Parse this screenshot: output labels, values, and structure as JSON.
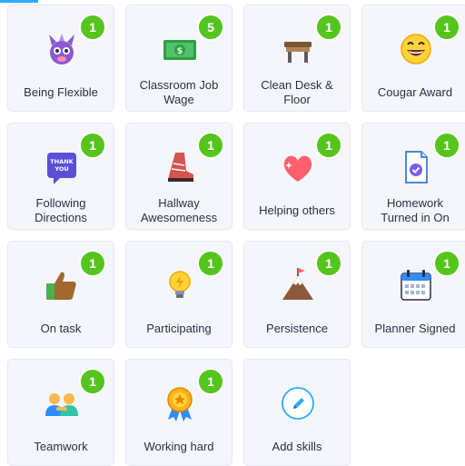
{
  "skills": [
    {
      "label": "Being Flexible",
      "count": "1",
      "icon": "monster-icon"
    },
    {
      "label": "Classroom Job\nWage",
      "count": "5",
      "icon": "money-icon"
    },
    {
      "label": "Clean Desk &\nFloor",
      "count": "1",
      "icon": "desk-icon"
    },
    {
      "label": "Cougar Award",
      "count": "1",
      "icon": "laughing-face-icon"
    },
    {
      "label": "Following\nDirections",
      "count": "1",
      "icon": "thank-you-note-icon",
      "icon_text": "THANK\nYOU"
    },
    {
      "label": "Hallway\nAwesomeness",
      "count": "1",
      "icon": "boot-icon"
    },
    {
      "label": "Helping others",
      "count": "1",
      "icon": "heart-icon"
    },
    {
      "label": "Homework\nTurned in On",
      "count": "1",
      "icon": "homework-paper-icon"
    },
    {
      "label": "On task",
      "count": "1",
      "icon": "thumbs-up-icon"
    },
    {
      "label": "Participating",
      "count": "1",
      "icon": "lightbulb-icon"
    },
    {
      "label": "Persistence",
      "count": "1",
      "icon": "mountain-flag-icon"
    },
    {
      "label": "Planner Signed",
      "count": "1",
      "icon": "calendar-icon"
    },
    {
      "label": "Teamwork",
      "count": "1",
      "icon": "team-icon"
    },
    {
      "label": "Working hard",
      "count": "1",
      "icon": "ribbon-medal-icon"
    }
  ],
  "add_skills": {
    "label": "Add skills",
    "icon": "pencil-icon"
  },
  "colors": {
    "badge": "#55c51e",
    "tile": "#f5f6fb",
    "accent": "#2fa8ff"
  }
}
